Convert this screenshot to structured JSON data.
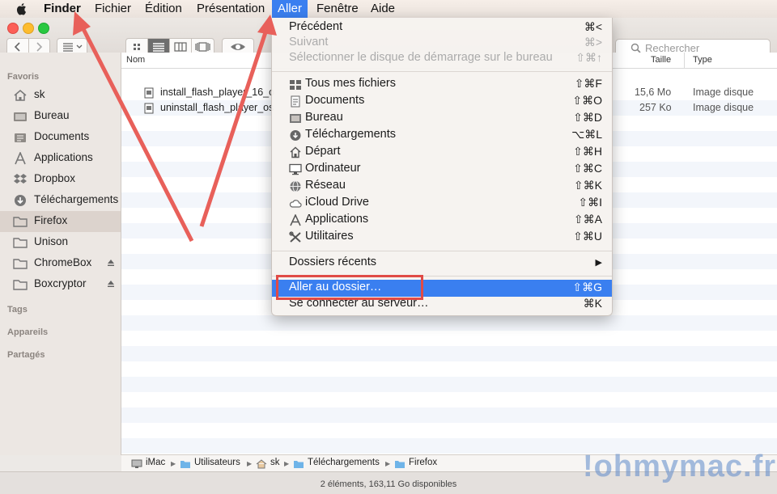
{
  "menubar": {
    "app": "Finder",
    "items": [
      "Fichier",
      "Édition",
      "Présentation",
      "Aller",
      "Fenêtre",
      "Aide"
    ],
    "active": "Aller"
  },
  "toolbar": {
    "search_placeholder": "Rechercher"
  },
  "sidebar": {
    "favorites_header": "Favoris",
    "items": [
      {
        "label": "sk",
        "icon": "home-icon"
      },
      {
        "label": "Bureau",
        "icon": "desktop-folder-icon"
      },
      {
        "label": "Documents",
        "icon": "documents-icon"
      },
      {
        "label": "Applications",
        "icon": "applications-icon"
      },
      {
        "label": "Dropbox",
        "icon": "dropbox-icon"
      },
      {
        "label": "Téléchargements",
        "icon": "downloads-icon"
      },
      {
        "label": "Firefox",
        "icon": "folder-icon",
        "selected": true
      },
      {
        "label": "Unison",
        "icon": "folder-icon"
      },
      {
        "label": "ChromeBox",
        "icon": "folder-icon",
        "eject": true
      },
      {
        "label": "Boxcryptor",
        "icon": "folder-icon",
        "eject": true
      }
    ],
    "tags_header": "Tags",
    "devices_header": "Appareils",
    "shared_header": "Partagés"
  },
  "columns": {
    "name": "Nom",
    "size": "Taille",
    "type": "Type"
  },
  "files": [
    {
      "name": "install_flash_player_16_o",
      "size": "15,6 Mo",
      "type": "Image disque"
    },
    {
      "name": "uninstall_flash_player_os",
      "size": "257 Ko",
      "type": "Image disque"
    }
  ],
  "go_menu": {
    "section1": [
      {
        "label": "Précédent",
        "shortcut": "⌘<",
        "disabled": false
      },
      {
        "label": "Suivant",
        "shortcut": "⌘>",
        "disabled": true
      },
      {
        "label": "Sélectionner le disque de démarrage sur le bureau",
        "shortcut": "⇧⌘↑",
        "disabled": true
      }
    ],
    "section2": [
      {
        "label": "Tous mes fichiers",
        "shortcut": "⇧⌘F",
        "icon": "all-files-icon"
      },
      {
        "label": "Documents",
        "shortcut": "⇧⌘O",
        "icon": "documents-icon"
      },
      {
        "label": "Bureau",
        "shortcut": "⇧⌘D",
        "icon": "desktop-icon"
      },
      {
        "label": "Téléchargements",
        "shortcut": "⌥⌘L",
        "icon": "downloads-icon"
      },
      {
        "label": "Départ",
        "shortcut": "⇧⌘H",
        "icon": "home-icon"
      },
      {
        "label": "Ordinateur",
        "shortcut": "⇧⌘C",
        "icon": "computer-icon"
      },
      {
        "label": "Réseau",
        "shortcut": "⇧⌘K",
        "icon": "network-icon"
      },
      {
        "label": "iCloud Drive",
        "shortcut": "⇧⌘I",
        "icon": "icloud-icon"
      },
      {
        "label": "Applications",
        "shortcut": "⇧⌘A",
        "icon": "applications-icon"
      },
      {
        "label": "Utilitaires",
        "shortcut": "⇧⌘U",
        "icon": "utilities-icon"
      }
    ],
    "recent": {
      "label": "Dossiers récents",
      "arrow": "▶"
    },
    "section4": [
      {
        "label": "Aller au dossier…",
        "shortcut": "⇧⌘G",
        "highlighted": true
      },
      {
        "label": "Se connecter au serveur…",
        "shortcut": "⌘K"
      }
    ]
  },
  "path": [
    "iMac",
    "Utilisateurs",
    "sk",
    "Téléchargements",
    "Firefox"
  ],
  "status": "2 éléments, 163,11 Go disponibles",
  "watermark": "!ohmymac.fr",
  "colors": {
    "accent": "#3a7ff0",
    "annotation": "#e04b46"
  }
}
